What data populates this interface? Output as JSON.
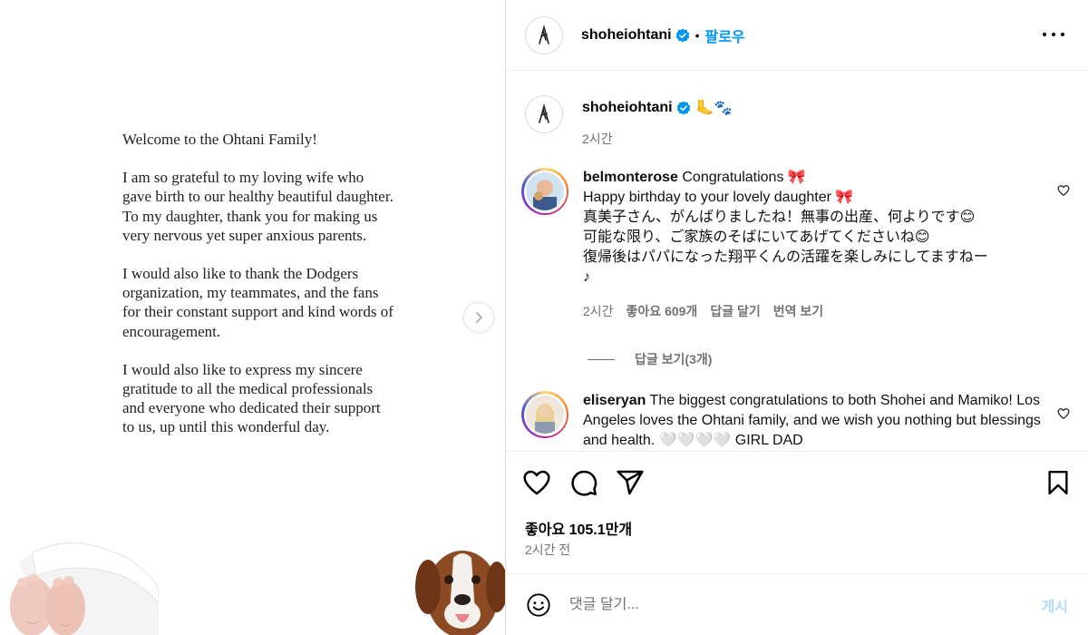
{
  "post": {
    "letter": {
      "paragraphs": [
        "Welcome to the Ohtani Family!",
        "I am so grateful to my loving wife who gave birth to our healthy beautiful daughter. To my daughter, thank you for making us very nervous yet super anxious parents.",
        "I would also like to thank the Dodgers organization, my teammates, and the fans for their constant support and kind words of encouragement.",
        "I would also like to express my sincere gratitude to all the medical professionals and everyone who dedicated their support to us, up until this wonderful day."
      ]
    }
  },
  "header": {
    "username": "shoheiohtani",
    "separator": "•",
    "follow_label": "팔로우"
  },
  "caption": {
    "username": "shoheiohtani",
    "emoji": "🦶🐾",
    "time": "2시간"
  },
  "comments": [
    {
      "username": "belmonterose",
      "text_lines": [
        " Congratulations 🎀",
        "Happy birthday to your lovely daughter 🎀",
        "真美子さん、がんばりましたね！無事の出産、何よりです😊",
        "可能な限り、ご家族のそばにいてあげてくださいね😊",
        "復帰後はパパになった翔平くんの活躍を楽しみにしてますねー",
        "♪"
      ],
      "time": "2시간",
      "likes": "좋아요 609개",
      "reply": "답글 달기",
      "translate": "번역 보기",
      "view_replies": "답글 보기(3개)"
    },
    {
      "username": "eliseryan",
      "text": " The biggest congratulations to both Shohei and Mamiko! Los Angeles loves the Ohtani family, and we wish you nothing but blessings and health. 🤍🤍🤍🤍 GIRL DAD"
    }
  ],
  "footer": {
    "likes": "좋아요 105.1만개",
    "time": "2시간 전",
    "comment_placeholder": "댓글 달기...",
    "post_label": "게시"
  },
  "colors": {
    "accent": "#0095f6",
    "verified": "#0095f6",
    "post_disabled": "#b3dbff",
    "muted": "#737373"
  },
  "icons": [
    "chevron-right-icon",
    "verified-icon",
    "more-icon",
    "heart-icon",
    "comment-icon",
    "share-icon",
    "bookmark-icon",
    "emoji-icon"
  ]
}
